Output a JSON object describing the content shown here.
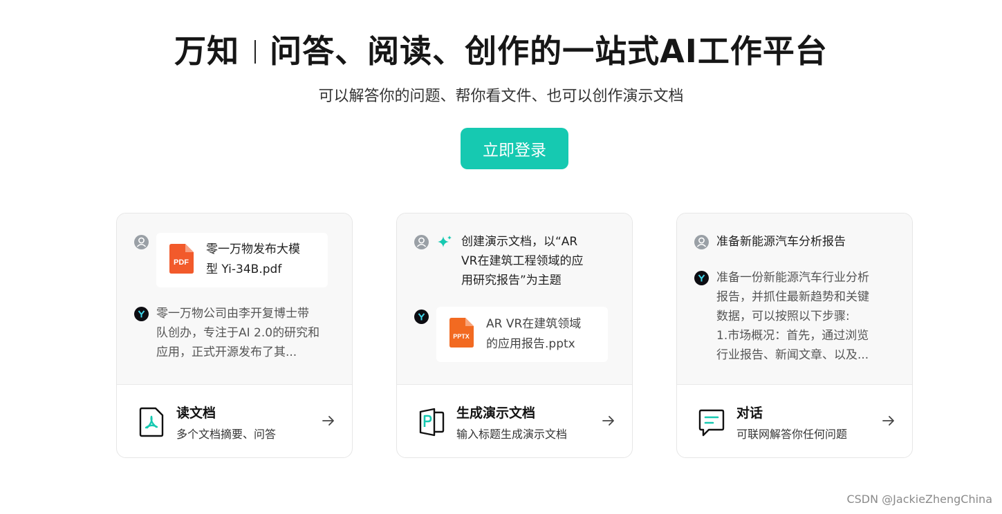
{
  "hero": {
    "brand": "万知",
    "tagline": "问答、阅读、创作的一站式AI工作平台",
    "subtitle": "可以解答你的问题、帮你看文件、也可以创作演示文档",
    "login_label": "立即登录"
  },
  "cards": [
    {
      "user_file": {
        "badge": "PDF",
        "name_line1": "零一万物发布大模",
        "name_line2": "型 Yi-34B.pdf"
      },
      "ai_reply": [
        "零一万物公司由李开复博士带",
        "队创办，专注于AI 2.0的研究和",
        "应用，正式开源发布了其..."
      ],
      "feature_title": "读文档",
      "feature_desc": "多个文档摘要、问答"
    },
    {
      "user_prompt": [
        "创建演示文档，以“AR",
        "VR在建筑工程领域的应",
        "用研究报告”为主题"
      ],
      "ai_file": {
        "badge": "PPTX",
        "name_line1": "AR VR在建筑领域",
        "name_line2": "的应用报告.pptx"
      },
      "feature_title": "生成演示文档",
      "feature_desc": "输入标题生成演示文档"
    },
    {
      "user_prompt": [
        "准备新能源汽车分析报告"
      ],
      "ai_reply": [
        "准备一份新能源汽车行业分析",
        "报告，并抓住最新趋势和关键",
        "数据，可以按照以下步骤:",
        "1.市场概况：首先，通过浏览",
        "行业报告、新闻文章、以及..."
      ],
      "feature_title": "对话",
      "feature_desc": "可联网解答你任何问题"
    }
  ],
  "watermark": "CSDN @JackieZhengChina",
  "colors": {
    "accent": "#16c9b1",
    "pdf": "#f25a2b",
    "pptx": "#f26a21"
  }
}
